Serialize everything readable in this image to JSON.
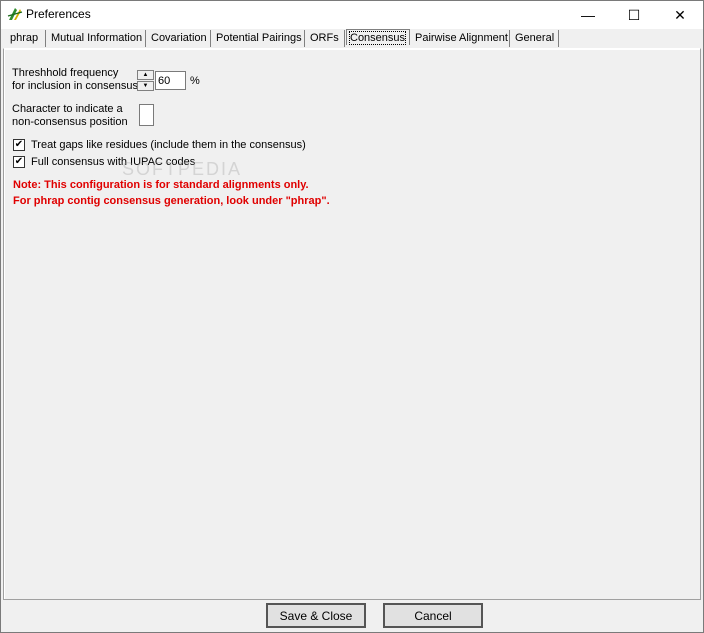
{
  "window": {
    "title": "Preferences",
    "min_glyph": "—",
    "max_glyph": "☐",
    "close_glyph": "✕"
  },
  "tabs": [
    {
      "label": "phrap"
    },
    {
      "label": "Mutual Information"
    },
    {
      "label": "Covariation"
    },
    {
      "label": "Potential Pairings"
    },
    {
      "label": "ORFs"
    },
    {
      "label": "Consensus",
      "active": true
    },
    {
      "label": "Pairwise Alignment"
    },
    {
      "label": "General"
    }
  ],
  "consensus": {
    "threshold_label_1": "Threshhold frequency",
    "threshold_label_2": "for inclusion in consensus",
    "threshold_value": "60",
    "percent_sign": "%",
    "spin_up": "▲",
    "spin_down": "▼",
    "char_label_1": "Character to indicate a",
    "char_label_2": "non-consensus position",
    "char_value": "",
    "gaps_label": "Treat gaps like residues (include them in the consensus)",
    "gaps_checked": true,
    "iupac_label": "Full consensus with IUPAC codes",
    "iupac_checked": true,
    "check_glyph": "✔",
    "note_1": "Note:  This configuration is for standard alignments only.",
    "note_2": "For phrap contig consensus generation, look under \"phrap\"."
  },
  "watermark": "SOFTPEDIA",
  "buttons": {
    "save": "Save & Close",
    "cancel": "Cancel"
  },
  "colors": {
    "note": "#e00000",
    "panel": "#f0f0f0"
  }
}
